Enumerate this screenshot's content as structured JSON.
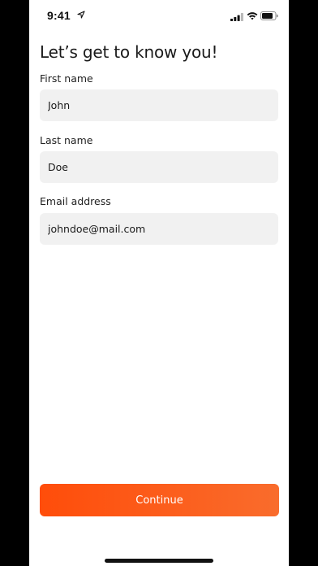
{
  "status_bar": {
    "time": "9:41",
    "icons": [
      "location-arrow-icon",
      "cellular-signal-icon",
      "wifi-icon",
      "battery-icon"
    ]
  },
  "page": {
    "title": "Let’s get to know you!"
  },
  "form": {
    "first_name": {
      "label": "First name",
      "value": "John"
    },
    "last_name": {
      "label": "Last name",
      "value": "Doe"
    },
    "email": {
      "label": "Email address",
      "value": "johndoe@mail.com"
    }
  },
  "actions": {
    "continue_label": "Continue"
  },
  "colors": {
    "accent_start": "#ff4d0a",
    "accent_end": "#f96c2c",
    "input_background": "#f1f1f1"
  }
}
